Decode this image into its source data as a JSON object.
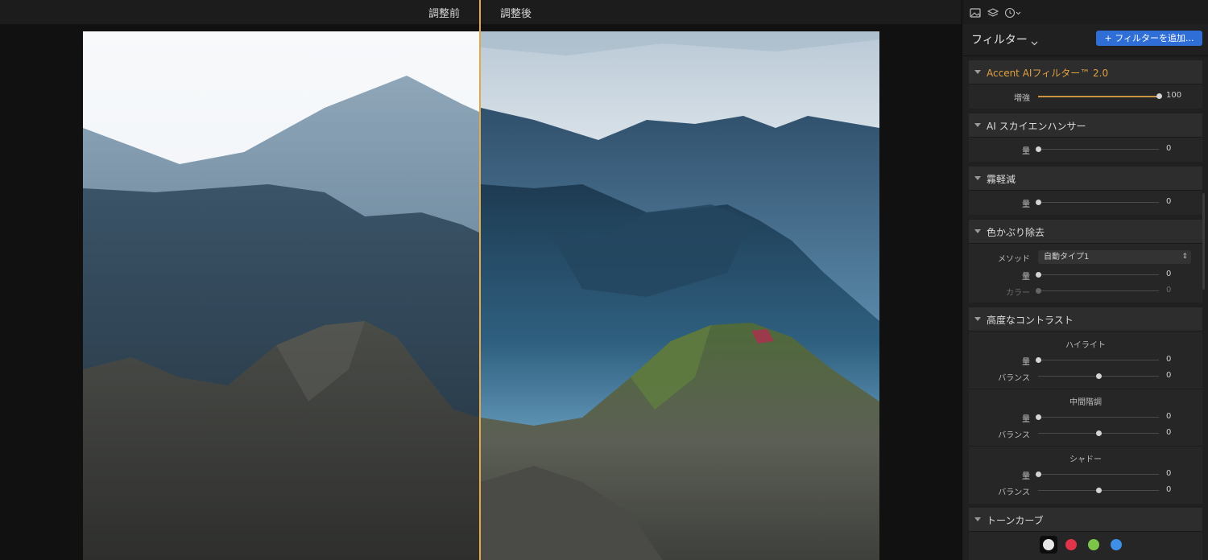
{
  "compare": {
    "before_label": "調整前",
    "after_label": "調整後"
  },
  "panel": {
    "title": "フィルター",
    "add_filter_label": "+ フィルターを追加...",
    "accent_color": "#e0a042",
    "button_color": "#2f6ed6"
  },
  "sections": {
    "accent_ai": {
      "title": "Accent AIフィルター™ 2.0",
      "boost_label": "増強",
      "boost_value": "100",
      "boost_level": 1.0
    },
    "sky_enhancer": {
      "title": "AI スカイエンハンサー",
      "amount_label": "量",
      "amount_value": "0",
      "amount_level": 0.0
    },
    "dehaze": {
      "title": "霧軽減",
      "amount_label": "量",
      "amount_value": "0",
      "amount_level": 0.0
    },
    "remove_cast": {
      "title": "色かぶり除去",
      "method_label": "メソッド",
      "method_value": "自動タイプ1",
      "amount_label": "量",
      "amount_value": "0",
      "amount_level": 0.0,
      "color_label": "カラー",
      "color_value": "0",
      "color_level": 0.0
    },
    "advanced_contrast": {
      "title": "高度なコントラスト",
      "highlights": {
        "title": "ハイライト",
        "amount_label": "量",
        "amount_value": "0",
        "amount_level": 0.0,
        "balance_label": "バランス",
        "balance_value": "0",
        "balance_level": 0.5
      },
      "midtones": {
        "title": "中間階調",
        "amount_label": "量",
        "amount_value": "0",
        "amount_level": 0.0,
        "balance_label": "バランス",
        "balance_value": "0",
        "balance_level": 0.5
      },
      "shadows": {
        "title": "シャドー",
        "amount_label": "量",
        "amount_value": "0",
        "amount_level": 0.0,
        "balance_label": "バランス",
        "balance_value": "0",
        "balance_level": 0.5
      }
    },
    "tone_curve": {
      "title": "トーンカーブ",
      "channels": [
        {
          "name": "luminance",
          "color": "#e8e8e8"
        },
        {
          "name": "red",
          "color": "#e0344a"
        },
        {
          "name": "green",
          "color": "#7cc44a"
        },
        {
          "name": "blue",
          "color": "#3f8fe8"
        }
      ]
    }
  }
}
